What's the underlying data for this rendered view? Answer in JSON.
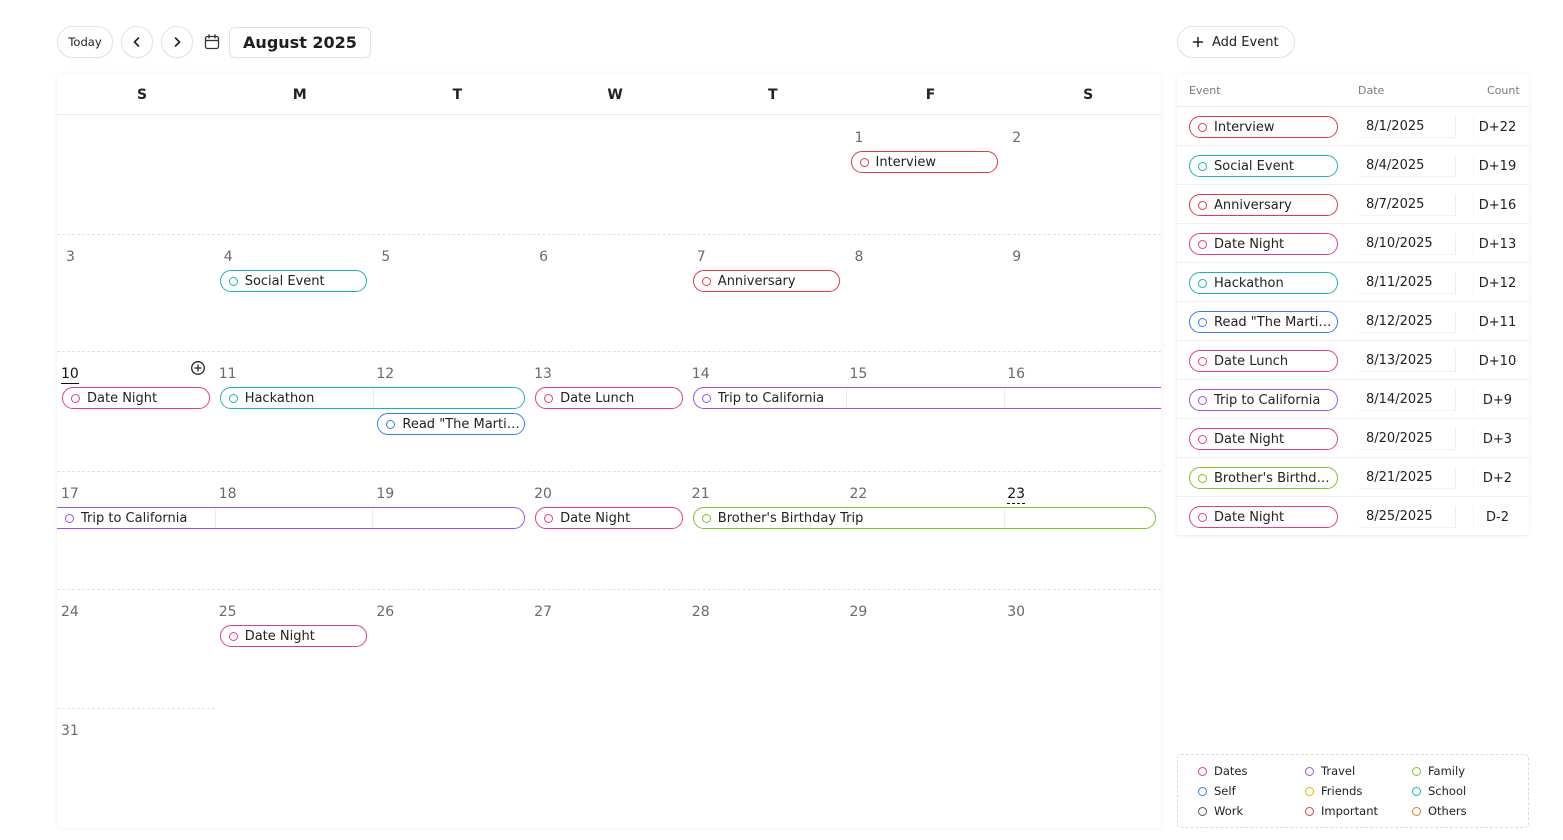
{
  "toolbar": {
    "today_label": "Today",
    "month_title": "August 2025",
    "add_event_label": "Add Event"
  },
  "colors": {
    "dates": "#e23d8d",
    "travel": "#a24fe0",
    "family": "#80c22a",
    "self": "#3b7ee0",
    "friends": "#e6b400",
    "school": "#1db5b0",
    "work": "#555555",
    "important": "#e03a48",
    "others": "#ef7a22"
  },
  "calendar": {
    "weekdays": [
      "S",
      "M",
      "T",
      "W",
      "T",
      "F",
      "S"
    ],
    "today": 10,
    "selected": 23,
    "days": [
      {
        "d": "1"
      },
      {
        "d": "2"
      },
      {
        "d": "3"
      },
      {
        "d": "4"
      },
      {
        "d": "5"
      },
      {
        "d": "6"
      },
      {
        "d": "7"
      },
      {
        "d": "8"
      },
      {
        "d": "9"
      },
      {
        "d": "10"
      },
      {
        "d": "11"
      },
      {
        "d": "12"
      },
      {
        "d": "13"
      },
      {
        "d": "14"
      },
      {
        "d": "15"
      },
      {
        "d": "16"
      },
      {
        "d": "17"
      },
      {
        "d": "18"
      },
      {
        "d": "19"
      },
      {
        "d": "20"
      },
      {
        "d": "21"
      },
      {
        "d": "22"
      },
      {
        "d": "23"
      },
      {
        "d": "24"
      },
      {
        "d": "25"
      },
      {
        "d": "26"
      },
      {
        "d": "27"
      },
      {
        "d": "28"
      },
      {
        "d": "29"
      },
      {
        "d": "30"
      },
      {
        "d": "31"
      }
    ],
    "events": [
      {
        "title": "Interview",
        "start": 1,
        "end": 1,
        "category": "important"
      },
      {
        "title": "Social Event",
        "start": 4,
        "end": 4,
        "category": "school"
      },
      {
        "title": "Anniversary",
        "start": 7,
        "end": 7,
        "category": "important"
      },
      {
        "title": "Date Night",
        "start": 10,
        "end": 10,
        "category": "dates"
      },
      {
        "title": "Hackathon",
        "start": 11,
        "end": 12,
        "category": "school"
      },
      {
        "title": "Read \"The Martian\"",
        "start": 12,
        "end": 12,
        "category": "self",
        "lane": 1
      },
      {
        "title": "Date Lunch",
        "start": 13,
        "end": 13,
        "category": "dates"
      },
      {
        "title": "Trip to California",
        "start": 14,
        "end": 19,
        "category": "travel"
      },
      {
        "title": "Date Night",
        "start": 20,
        "end": 20,
        "category": "dates"
      },
      {
        "title": "Brother's Birthday Trip",
        "start": 21,
        "end": 23,
        "category": "family"
      },
      {
        "title": "Date Night",
        "start": 25,
        "end": 25,
        "category": "dates"
      }
    ]
  },
  "table": {
    "headers": {
      "event": "Event",
      "date": "Date",
      "count": "Count"
    },
    "rows": [
      {
        "event": "Interview",
        "date": "8/1/2025",
        "count": "D+22",
        "category": "important"
      },
      {
        "event": "Social Event",
        "date": "8/4/2025",
        "count": "D+19",
        "category": "school"
      },
      {
        "event": "Anniversary",
        "date": "8/7/2025",
        "count": "D+16",
        "category": "important"
      },
      {
        "event": "Date Night",
        "date": "8/10/2025",
        "count": "D+13",
        "category": "dates"
      },
      {
        "event": "Hackathon",
        "date": "8/11/2025",
        "count": "D+12",
        "category": "school"
      },
      {
        "event": "Read \"The Martian\"",
        "date": "8/12/2025",
        "count": "D+11",
        "category": "self"
      },
      {
        "event": "Date Lunch",
        "date": "8/13/2025",
        "count": "D+10",
        "category": "dates"
      },
      {
        "event": "Trip to California",
        "date": "8/14/2025",
        "count": "D+9",
        "category": "travel"
      },
      {
        "event": "Date Night",
        "date": "8/20/2025",
        "count": "D+3",
        "category": "dates"
      },
      {
        "event": "Brother's Birthday Trip",
        "date": "8/21/2025",
        "count": "D+2",
        "category": "family"
      },
      {
        "event": "Date Night",
        "date": "8/25/2025",
        "count": "D-2",
        "category": "dates"
      }
    ]
  },
  "legend": [
    {
      "label": "Dates",
      "category": "dates"
    },
    {
      "label": "Travel",
      "category": "travel"
    },
    {
      "label": "Family",
      "category": "family"
    },
    {
      "label": "Self",
      "category": "self"
    },
    {
      "label": "Friends",
      "category": "friends"
    },
    {
      "label": "School",
      "category": "school"
    },
    {
      "label": "Work",
      "category": "work"
    },
    {
      "label": "Important",
      "category": "important"
    },
    {
      "label": "Others",
      "category": "others"
    }
  ],
  "icons": {
    "prev": "chevron-left-icon",
    "next": "chevron-right-icon",
    "calendar": "calendar-icon",
    "add": "plus-icon",
    "add_day": "plus-circle-icon"
  }
}
